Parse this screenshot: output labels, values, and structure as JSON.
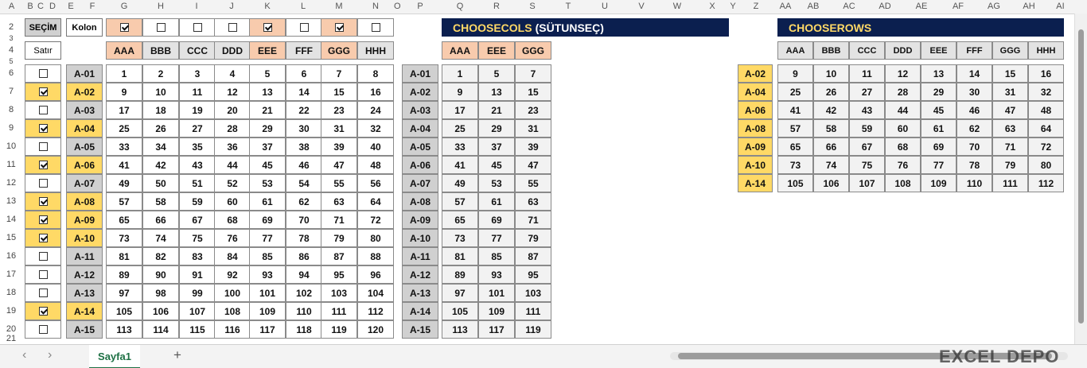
{
  "column_letters": [
    "A",
    "B",
    "C",
    "D",
    "E",
    "F",
    "G",
    "H",
    "I",
    "J",
    "K",
    "L",
    "M",
    "N",
    "O",
    "P",
    "Q",
    "R",
    "S",
    "T",
    "U",
    "V",
    "W",
    "X",
    "Y",
    "Z",
    "AA",
    "AB",
    "AC",
    "AD",
    "AE",
    "AF",
    "AG",
    "AH",
    "AI"
  ],
  "row_numbers": [
    "2",
    "3",
    "4",
    "5",
    "6",
    "7",
    "8",
    "9",
    "10",
    "11",
    "12",
    "13",
    "14",
    "15",
    "16",
    "17",
    "18",
    "19",
    "20",
    "21"
  ],
  "controls": {
    "secim_label": "SEÇİM",
    "kolon_label": "Kolon",
    "satir_label": "Satır"
  },
  "column_headers": [
    "AAA",
    "BBB",
    "CCC",
    "DDD",
    "EEE",
    "FFF",
    "GGG",
    "HHH"
  ],
  "column_checks": [
    true,
    false,
    false,
    false,
    true,
    false,
    true,
    false
  ],
  "row_ids": [
    "A-01",
    "A-02",
    "A-03",
    "A-04",
    "A-05",
    "A-06",
    "A-07",
    "A-08",
    "A-09",
    "A-10",
    "A-11",
    "A-12",
    "A-13",
    "A-14",
    "A-15"
  ],
  "row_checks": [
    false,
    true,
    false,
    true,
    false,
    true,
    false,
    true,
    true,
    true,
    false,
    false,
    false,
    true,
    false
  ],
  "grid": [
    [
      "1",
      "2",
      "3",
      "4",
      "5",
      "6",
      "7",
      "8"
    ],
    [
      "9",
      "10",
      "11",
      "12",
      "13",
      "14",
      "15",
      "16"
    ],
    [
      "17",
      "18",
      "19",
      "20",
      "21",
      "22",
      "23",
      "24"
    ],
    [
      "25",
      "26",
      "27",
      "28",
      "29",
      "30",
      "31",
      "32"
    ],
    [
      "33",
      "34",
      "35",
      "36",
      "37",
      "38",
      "39",
      "40"
    ],
    [
      "41",
      "42",
      "43",
      "44",
      "45",
      "46",
      "47",
      "48"
    ],
    [
      "49",
      "50",
      "51",
      "52",
      "53",
      "54",
      "55",
      "56"
    ],
    [
      "57",
      "58",
      "59",
      "60",
      "61",
      "62",
      "63",
      "64"
    ],
    [
      "65",
      "66",
      "67",
      "68",
      "69",
      "70",
      "71",
      "72"
    ],
    [
      "73",
      "74",
      "75",
      "76",
      "77",
      "78",
      "79",
      "80"
    ],
    [
      "81",
      "82",
      "83",
      "84",
      "85",
      "86",
      "87",
      "88"
    ],
    [
      "89",
      "90",
      "91",
      "92",
      "93",
      "94",
      "95",
      "96"
    ],
    [
      "97",
      "98",
      "99",
      "100",
      "101",
      "102",
      "103",
      "104"
    ],
    [
      "105",
      "106",
      "107",
      "108",
      "109",
      "110",
      "111",
      "112"
    ],
    [
      "113",
      "114",
      "115",
      "116",
      "117",
      "118",
      "119",
      "120"
    ]
  ],
  "choosecols": {
    "title": "CHOOSECOLS",
    "subtitle": "(SÜTUNSEÇ)",
    "headers": [
      "AAA",
      "EEE",
      "GGG"
    ],
    "rows": [
      [
        "1",
        "5",
        "7"
      ],
      [
        "9",
        "13",
        "15"
      ],
      [
        "17",
        "21",
        "23"
      ],
      [
        "25",
        "29",
        "31"
      ],
      [
        "33",
        "37",
        "39"
      ],
      [
        "41",
        "45",
        "47"
      ],
      [
        "49",
        "53",
        "55"
      ],
      [
        "57",
        "61",
        "63"
      ],
      [
        "65",
        "69",
        "71"
      ],
      [
        "73",
        "77",
        "79"
      ],
      [
        "81",
        "85",
        "87"
      ],
      [
        "89",
        "93",
        "95"
      ],
      [
        "97",
        "101",
        "103"
      ],
      [
        "105",
        "109",
        "111"
      ],
      [
        "113",
        "117",
        "119"
      ]
    ]
  },
  "chooserows": {
    "title": "CHOOSEROWS",
    "headers": [
      "AAA",
      "BBB",
      "CCC",
      "DDD",
      "EEE",
      "FFF",
      "GGG",
      "HHH"
    ],
    "ids": [
      "A-02",
      "A-04",
      "A-06",
      "A-08",
      "A-09",
      "A-10",
      "A-14"
    ],
    "rows": [
      [
        "9",
        "10",
        "11",
        "12",
        "13",
        "14",
        "15",
        "16"
      ],
      [
        "25",
        "26",
        "27",
        "28",
        "29",
        "30",
        "31",
        "32"
      ],
      [
        "41",
        "42",
        "43",
        "44",
        "45",
        "46",
        "47",
        "48"
      ],
      [
        "57",
        "58",
        "59",
        "60",
        "61",
        "62",
        "63",
        "64"
      ],
      [
        "65",
        "66",
        "67",
        "68",
        "69",
        "70",
        "71",
        "72"
      ],
      [
        "73",
        "74",
        "75",
        "76",
        "77",
        "78",
        "79",
        "80"
      ],
      [
        "105",
        "106",
        "107",
        "108",
        "109",
        "110",
        "111",
        "112"
      ]
    ]
  },
  "tabs": {
    "sheet_name": "Sayfa1",
    "add": "+",
    "prev": "‹",
    "next": "›"
  },
  "watermark": "EXCEL DEPO",
  "colors": {
    "navy": "#0b1f4f",
    "yellow": "#ffd966",
    "peach": "#f8cbad",
    "gray": "#d0d0d0"
  }
}
